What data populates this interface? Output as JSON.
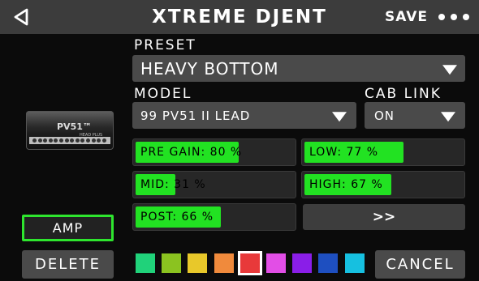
{
  "header": {
    "title": "XTREME DJENT",
    "save_label": "SAVE"
  },
  "preset": {
    "label": "PRESET",
    "value": "HEAVY BOTTOM"
  },
  "model": {
    "label": "MODEL",
    "value": "99 PV51 II LEAD"
  },
  "cab_link": {
    "label": "CAB LINK",
    "value": "ON"
  },
  "amp_image": {
    "badge": "PV51™",
    "sub": "HEAD PLUS"
  },
  "params": [
    {
      "name": "PRE GAIN",
      "text": "PRE GAIN: 80 %",
      "value": 80
    },
    {
      "name": "LOW",
      "text": "LOW: 77 %",
      "value": 77
    },
    {
      "name": "MID",
      "text": "MID: 31 %",
      "value": 31
    },
    {
      "name": "HIGH",
      "text": "HIGH: 67 %",
      "value": 67
    },
    {
      "name": "POST",
      "text": "POST: 66 %",
      "value": 66
    }
  ],
  "next_label": ">>",
  "amp_button": "AMP",
  "delete_label": "DELETE",
  "cancel_label": "CANCEL",
  "colors": {
    "accent": "#22e222",
    "swatches": [
      "#20d27a",
      "#8bc320",
      "#e8c82a",
      "#f08a3c",
      "#e8393a",
      "#e24ee6",
      "#8a1ee8",
      "#1e4fc0",
      "#16c0e0"
    ],
    "selected_swatch": 4
  }
}
